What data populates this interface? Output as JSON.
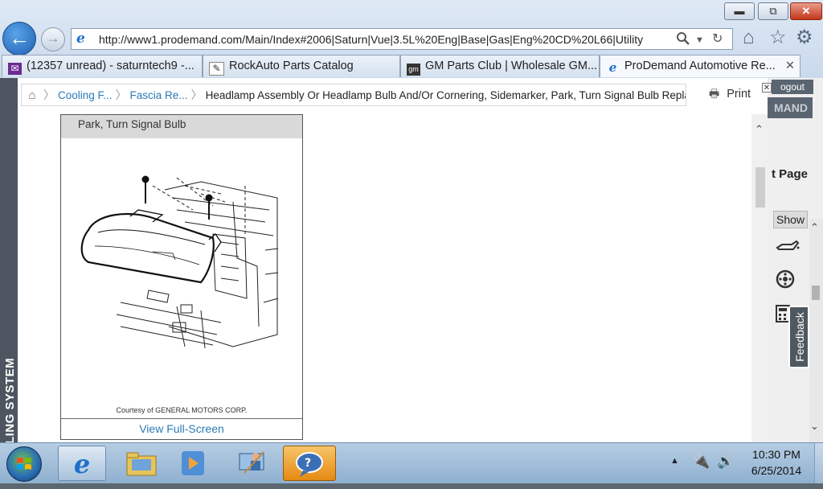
{
  "window": {
    "min_glyph": "▬",
    "restore_glyph": "⧉",
    "close_glyph": "✕"
  },
  "address": {
    "url": "http://www1.prodemand.com/Main/Index#2006|Saturn|Vue|3.5L%20Eng|Base|Gas|Eng%20CD%20L66|Utility"
  },
  "tabs": [
    {
      "label": "(12357 unread) - saturntech9 -...",
      "icon": "mail-icon"
    },
    {
      "label": "RockAuto Parts Catalog",
      "icon": "rockauto-icon"
    },
    {
      "label": "GM Parts Club | Wholesale GM...",
      "icon": "gm-icon"
    },
    {
      "label": "ProDemand Automotive Re...",
      "icon": "ie-icon",
      "close": "✕"
    }
  ],
  "breadcrumb": {
    "items": [
      {
        "label": "Cooling F..."
      },
      {
        "label": "Fascia Re..."
      },
      {
        "label": "Headlamp Assembly Or Headlamp Bulb And/Or Cornering, Sidemarker, Park, Turn Signal Bulb Replacement"
      }
    ]
  },
  "toolbar": {
    "print_label": "Print"
  },
  "figure": {
    "title_fragment": "Park, Turn Signal Bulb",
    "credit": "Courtesy of GENERAL MOTORS CORP.",
    "fullscreen_label": "View Full-Screen"
  },
  "background_page": {
    "logout_fragment": "ogout",
    "brand_fragment": "MAND",
    "page_label_fragment": "t Page",
    "show_label": "Show",
    "feedback_label": "Feedback",
    "left_vertical_label": "LING SYSTEM"
  },
  "taskbar": {
    "apps": [
      "start-orb",
      "internet-explorer",
      "file-explorer",
      "media-player",
      "remote-desktop",
      "prodemand-app"
    ],
    "clock_time": "10:30 PM",
    "clock_date": "6/25/2014"
  }
}
